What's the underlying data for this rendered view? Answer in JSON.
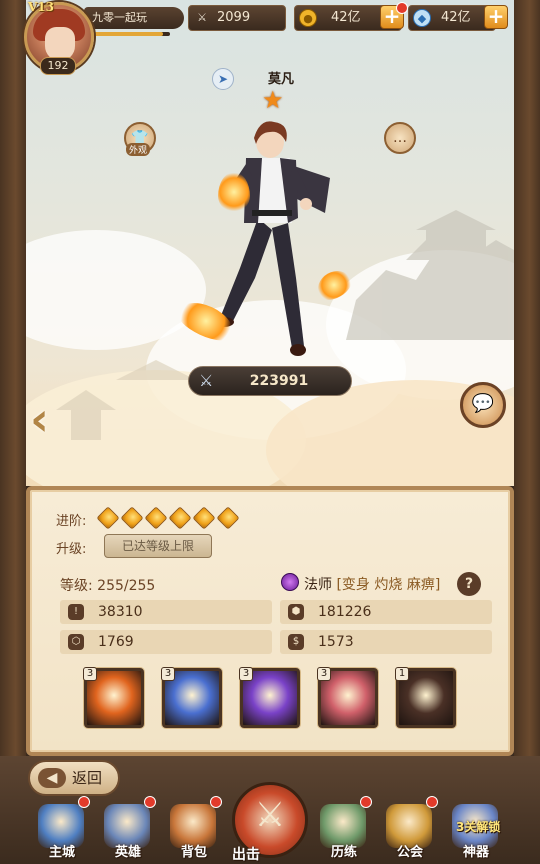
{
  "player": {
    "vip": "V13",
    "level": "192",
    "name": "九零一起玩",
    "exp_fraction": 0.92
  },
  "resources": {
    "combat_power": "2099",
    "gold": "42亿",
    "diamond": "42亿",
    "plus_label": "+"
  },
  "hero": {
    "name": "莫凡",
    "star_count": 1,
    "power": "223991",
    "appearance_label": "外观"
  },
  "panel": {
    "advance_label": "进阶:",
    "advance_stars": 6,
    "upgrade_label": "升级:",
    "upgrade_status": "已达等级上限",
    "level_label": "等级:",
    "level_value": "255/255",
    "class_name": "法师",
    "class_tags": "[变身 灼烧 麻痹]",
    "help_label": "?",
    "stats": [
      {
        "icon": "attack-icon",
        "value": "38310"
      },
      {
        "icon": "hp-icon",
        "value": "181226"
      },
      {
        "icon": "defense-icon",
        "value": "1769"
      },
      {
        "icon": "speed-icon",
        "value": "1573"
      }
    ],
    "skills": [
      {
        "level": "3",
        "color": "#e0641e"
      },
      {
        "level": "3",
        "color": "#4a6fd0"
      },
      {
        "level": "3",
        "color": "#7a42c8"
      },
      {
        "level": "3",
        "color": "#d0606a"
      },
      {
        "level": "1",
        "color": "#4a3026"
      }
    ]
  },
  "nav": {
    "back_label": "返回",
    "items": [
      {
        "label": "主城",
        "name": "nav-main-city",
        "color": "#4f7fc2",
        "dot": true
      },
      {
        "label": "英雄",
        "name": "nav-heroes",
        "color": "#6a86b8",
        "dot": true
      },
      {
        "label": "背包",
        "name": "nav-bag",
        "color": "#c8763a",
        "dot": true
      },
      {
        "label": "出击",
        "name": "nav-battle",
        "color": "#c94a2a",
        "dot": false
      },
      {
        "label": "历练",
        "name": "nav-training",
        "color": "#6f9a6a",
        "dot": true
      },
      {
        "label": "公会",
        "name": "nav-guild",
        "color": "#d09a3a",
        "dot": true
      },
      {
        "label": "神器",
        "name": "nav-artifact",
        "color": "#6a86c8",
        "dot": false
      }
    ],
    "artifact_lock_text": "3关解锁"
  }
}
